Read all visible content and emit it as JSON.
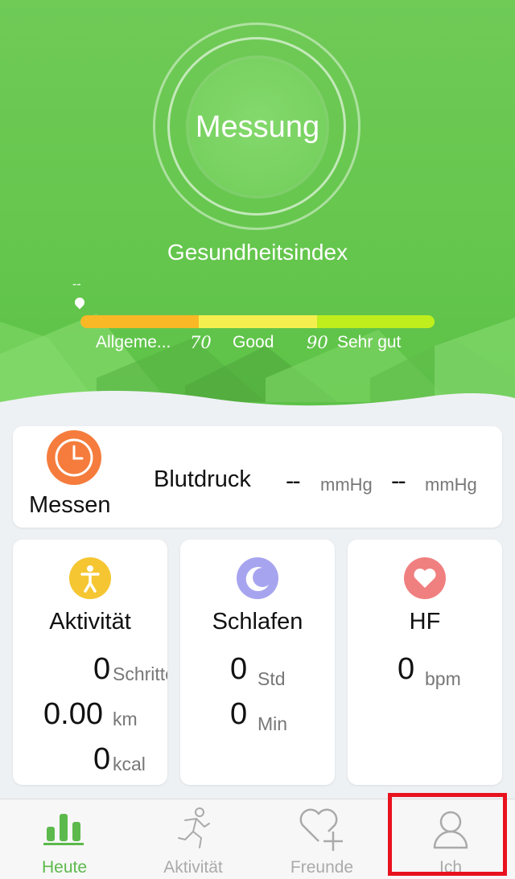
{
  "measure_label": "Messung",
  "health_index": {
    "title": "Gesundheitsindex",
    "value": "--",
    "scale": [
      {
        "label": "Allgeme...",
        "color": "#f9b826"
      },
      {
        "label": "Good",
        "color": "#f4ef4f"
      },
      {
        "label": "Sehr gut",
        "color": "#c0ee1c"
      }
    ],
    "threshold_1": "70",
    "threshold_2": "90"
  },
  "blood_pressure": {
    "action_label": "Messen",
    "label": "Blutdruck",
    "systolic": "--",
    "systolic_unit": "mmHg",
    "diastolic": "--",
    "diastolic_unit": "mmHg"
  },
  "activity": {
    "title": "Aktivität",
    "steps": "0",
    "steps_unit": "Schritte",
    "distance": "0.00",
    "distance_unit": "km",
    "calories": "0",
    "calories_unit": "kcal"
  },
  "sleep": {
    "title": "Schlafen",
    "hours": "0",
    "hours_unit": "Std",
    "minutes": "0",
    "minutes_unit": "Min"
  },
  "heart_rate": {
    "title": "HF",
    "value": "0",
    "unit": "bpm"
  },
  "tabs": [
    {
      "label": "Heute",
      "icon": "bar-chart-icon"
    },
    {
      "label": "Aktivität",
      "icon": "running-icon"
    },
    {
      "label": "Freunde",
      "icon": "heart-plus-icon"
    },
    {
      "label": "Ich",
      "icon": "person-icon"
    }
  ],
  "colors": {
    "accent": "#5cb94c",
    "clock": "#f57c3c",
    "activity": "#f5c631",
    "sleep": "#a7a4ef",
    "heart": "#f08080",
    "highlight": "#e8121e"
  }
}
